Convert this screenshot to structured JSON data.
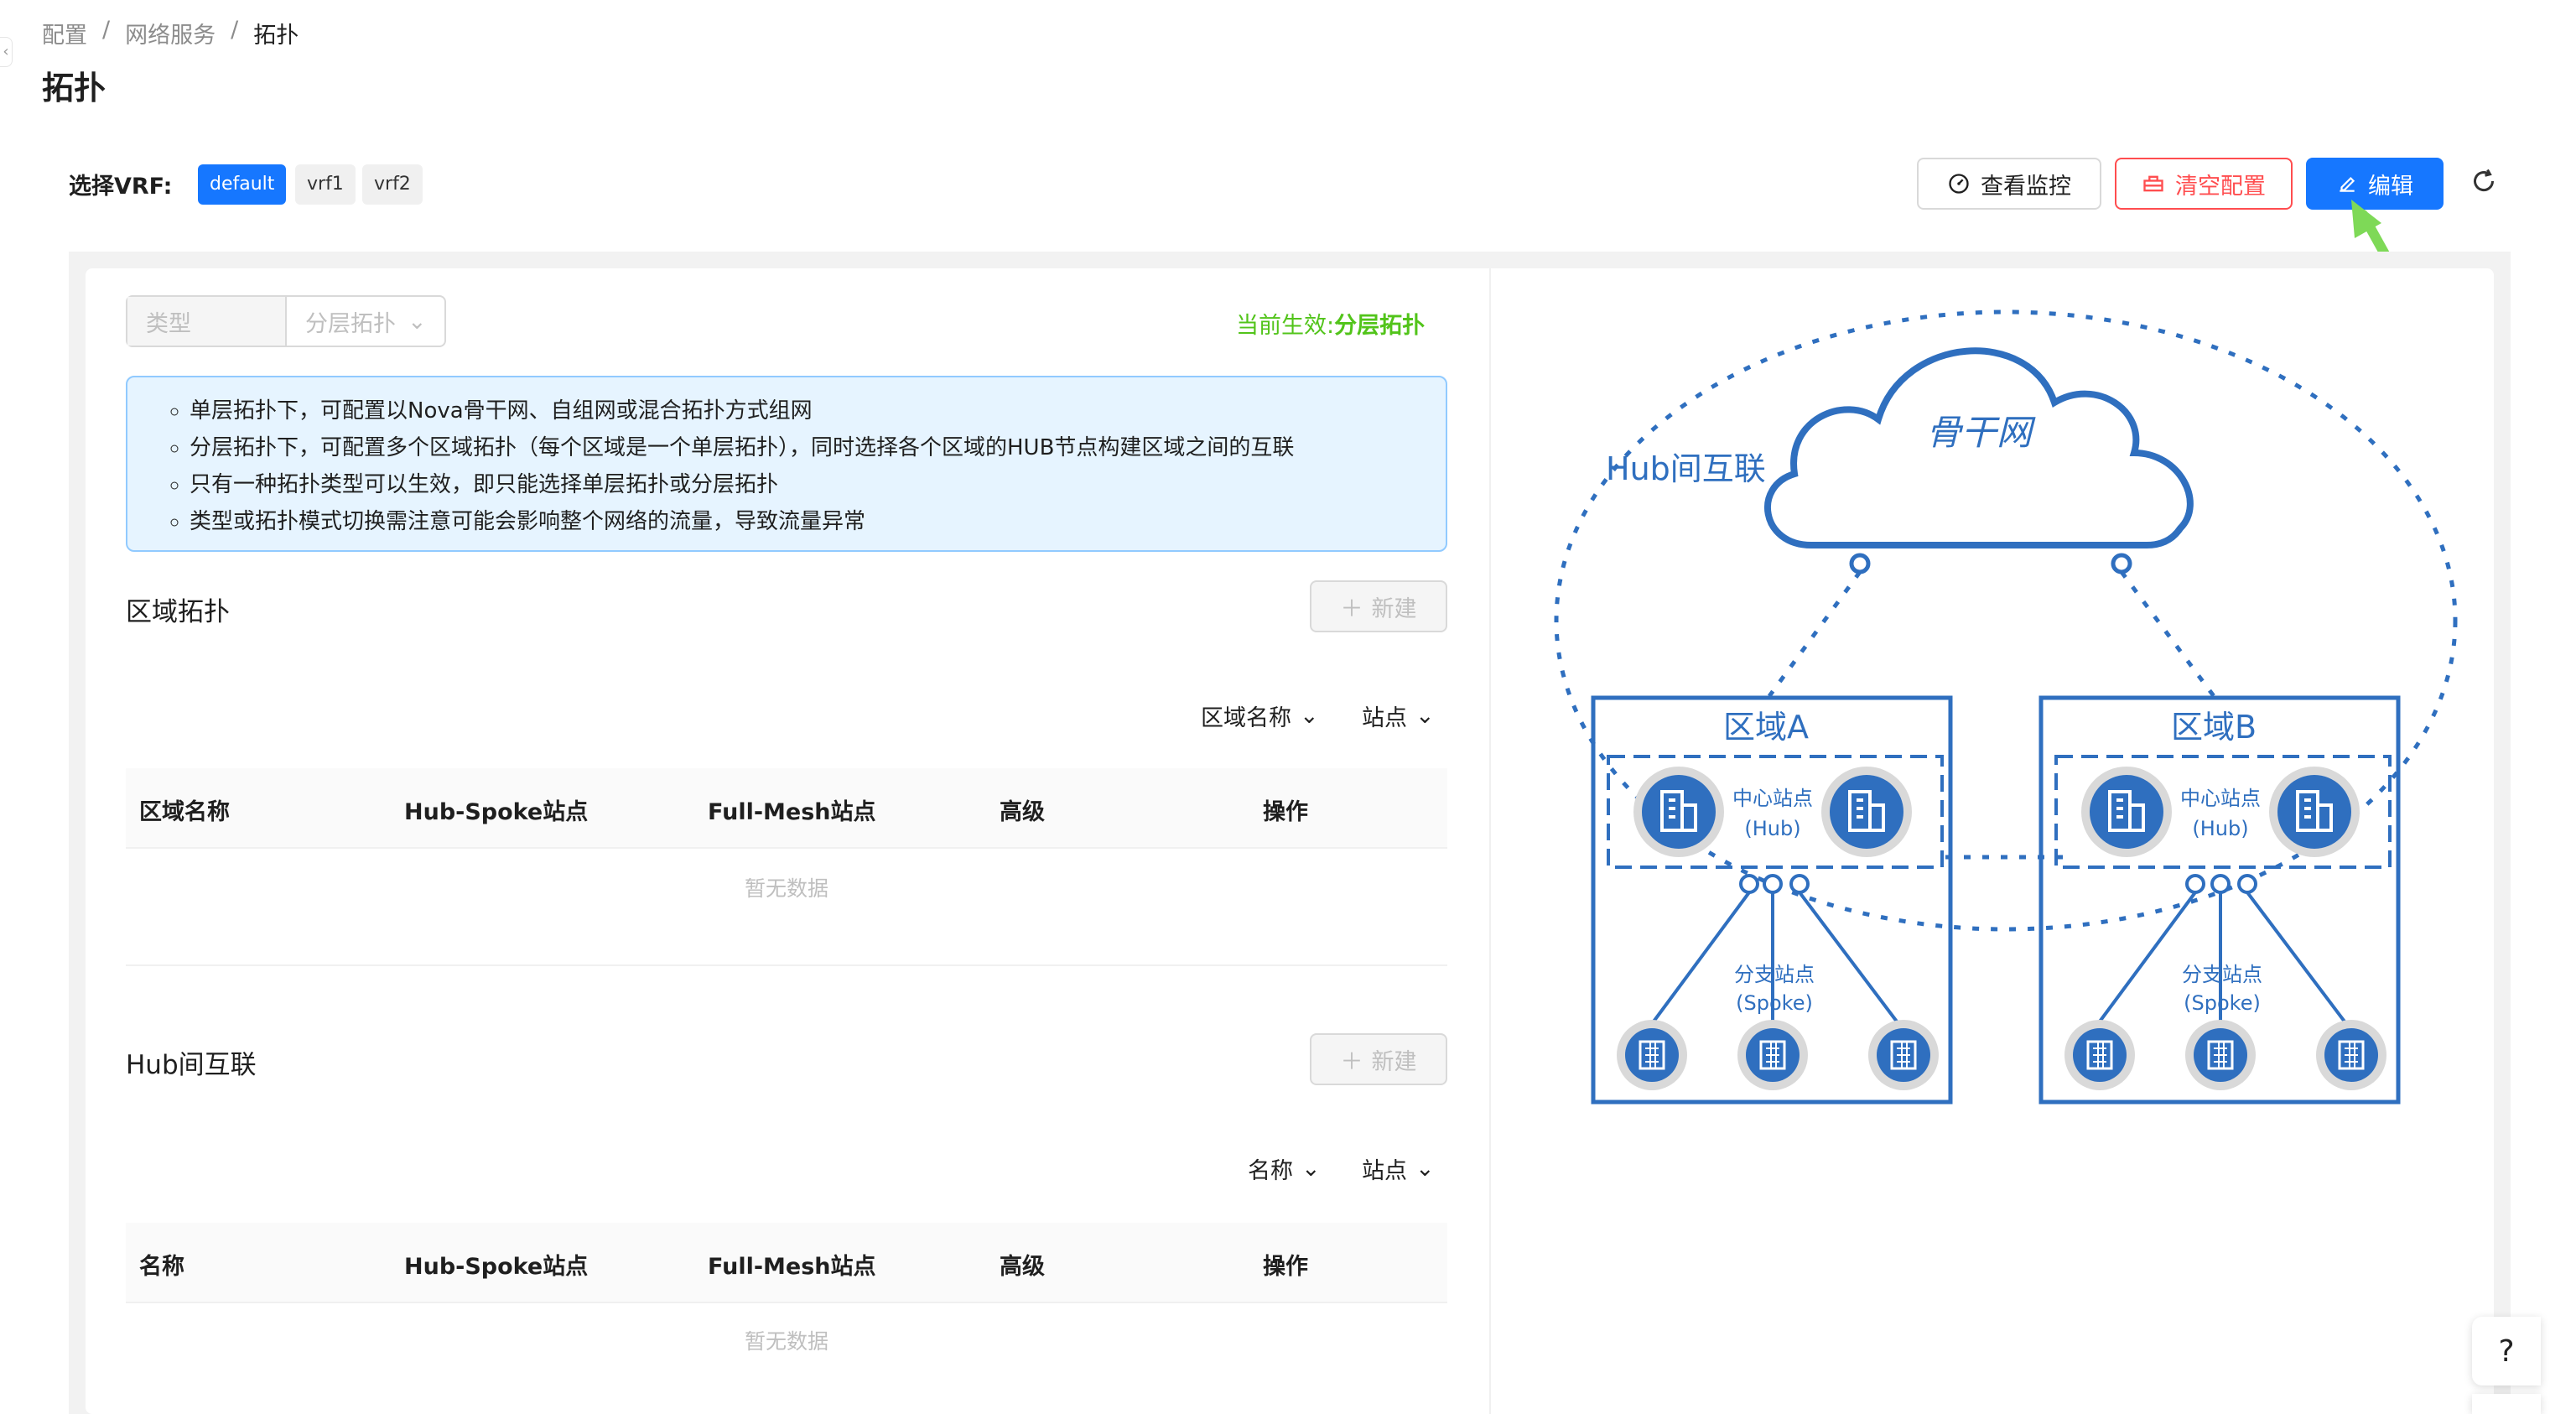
{
  "breadcrumb": [
    "配置",
    "网络服务",
    "拓扑"
  ],
  "breadcrumb_sep": "/",
  "page_title": "拓扑",
  "vrf": {
    "label": "选择VRF:",
    "options": [
      "default",
      "vrf1",
      "vrf2"
    ],
    "selected": "default"
  },
  "toolbar": {
    "monitor_label": "查看监控",
    "clear_label": "清空配置",
    "edit_label": "编辑"
  },
  "type_select": {
    "label": "类型",
    "value": "分层拓扑"
  },
  "effective": {
    "prefix": "当前生效:",
    "value": "分层拓扑"
  },
  "info": [
    "单层拓扑下，可配置以Nova骨干网、自组网或混合拓扑方式组网",
    "分层拓扑下，可配置多个区域拓扑（每个区域是一个单层拓扑），同时选择各个区域的HUB节点构建区域之间的互联",
    "只有一种拓扑类型可以生效，即只能选择单层拓扑或分层拓扑",
    "类型或拓扑模式切换需注意可能会影响整个网络的流量，导致流量异常"
  ],
  "region": {
    "title": "区域拓扑",
    "new_label": "新建",
    "filters": [
      "区域名称",
      "站点"
    ],
    "columns": [
      "区域名称",
      "Hub-Spoke站点",
      "Full-Mesh站点",
      "高级",
      "操作"
    ],
    "empty": "暂无数据"
  },
  "hub": {
    "title": "Hub间互联",
    "new_label": "新建",
    "filters": [
      "名称",
      "站点"
    ],
    "columns": [
      "名称",
      "Hub-Spoke站点",
      "Full-Mesh站点",
      "高级",
      "操作"
    ],
    "empty": "暂无数据"
  },
  "diagram": {
    "backbone": "骨干网",
    "hub_interconnect": "Hub间互联",
    "region_a": "区域A",
    "region_b": "区域B",
    "hub_label": "中心站点",
    "hub_sub": "(Hub)",
    "spoke_label": "分支站点",
    "spoke_sub": "(Spoke)"
  },
  "colors": {
    "primary": "#1677ff",
    "danger": "#ff4d4f",
    "success": "#52c41a",
    "diagram_blue": "#2f6fbf",
    "arrow_green": "#7ed957"
  }
}
